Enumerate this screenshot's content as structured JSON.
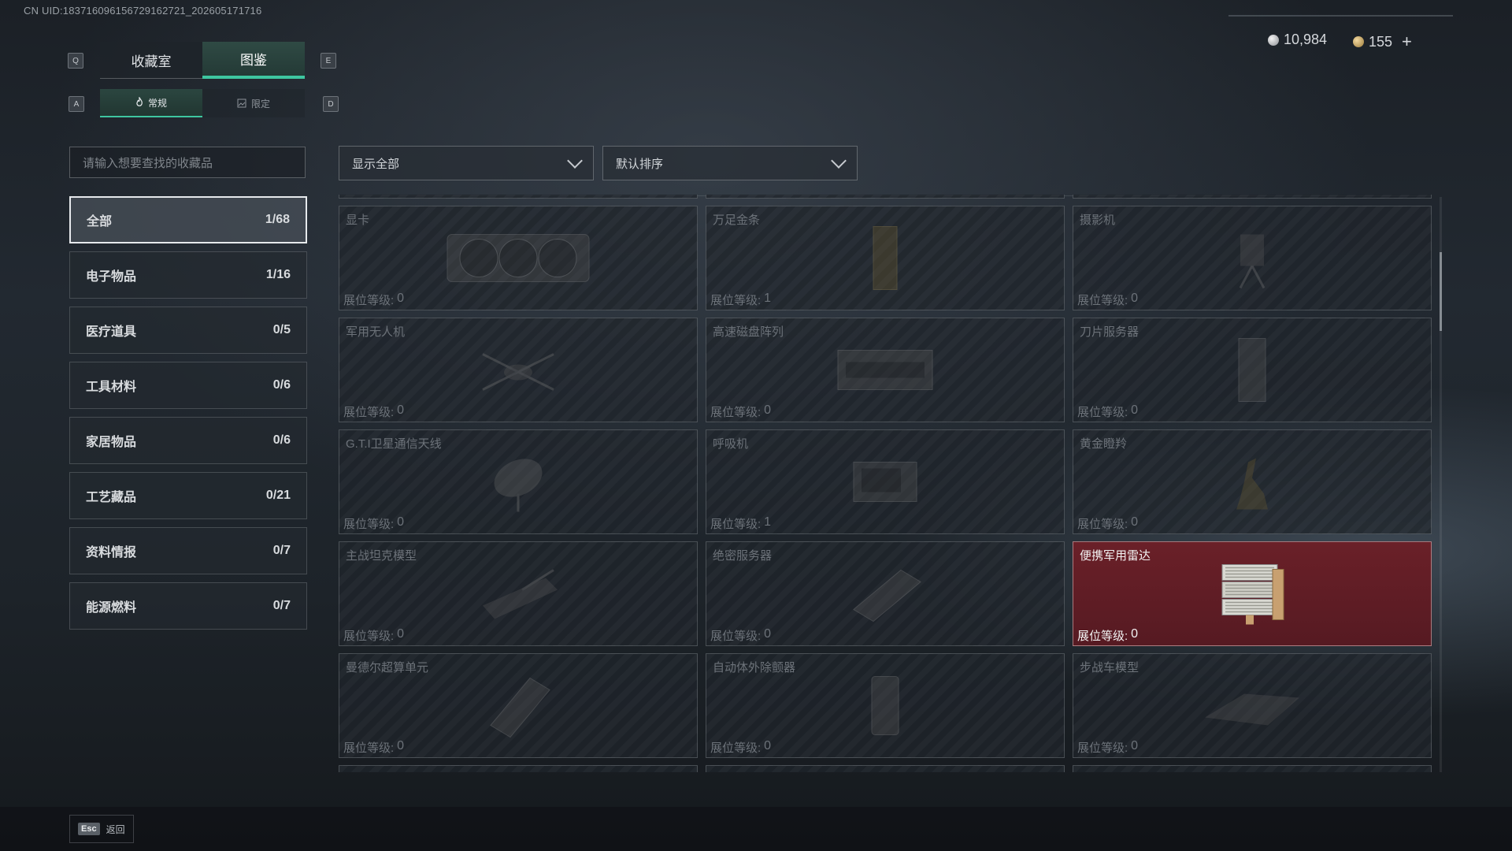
{
  "uid": "CN UID:183716096156729162721_202605171716",
  "currency": {
    "silver": "10,984",
    "gold": "155",
    "add": "+"
  },
  "keys": {
    "prev_tab": "Q",
    "next_tab": "E",
    "prev_sub": "A",
    "next_sub": "D"
  },
  "tabs": [
    {
      "label": "收藏室"
    },
    {
      "label": "图鉴"
    }
  ],
  "subtabs": [
    {
      "label": "常规"
    },
    {
      "label": "限定"
    }
  ],
  "search": {
    "placeholder": "请输入想要查找的收藏品"
  },
  "filters": {
    "show": "显示全部",
    "sort": "默认排序"
  },
  "categories": [
    {
      "label": "全部",
      "count": "1/68"
    },
    {
      "label": "电子物品",
      "count": "1/16"
    },
    {
      "label": "医疗道具",
      "count": "0/5"
    },
    {
      "label": "工具材料",
      "count": "0/6"
    },
    {
      "label": "家居物品",
      "count": "0/6"
    },
    {
      "label": "工艺藏品",
      "count": "0/21"
    },
    {
      "label": "资料情报",
      "count": "0/7"
    },
    {
      "label": "能源燃料",
      "count": "0/7"
    }
  ],
  "level_label": "展位等级:",
  "items": [
    {
      "name": "显卡",
      "level": "0",
      "icon": "gpu-icon"
    },
    {
      "name": "万足金条",
      "level": "1",
      "icon": "gold-bar-icon"
    },
    {
      "name": "摄影机",
      "level": "0",
      "icon": "camera-icon"
    },
    {
      "name": "军用无人机",
      "level": "0",
      "icon": "drone-icon"
    },
    {
      "name": "高速磁盘阵列",
      "level": "0",
      "icon": "disk-array-icon"
    },
    {
      "name": "刀片服务器",
      "level": "0",
      "icon": "blade-server-icon"
    },
    {
      "name": "G.T.I卫星通信天线",
      "level": "0",
      "icon": "satellite-dish-icon"
    },
    {
      "name": "呼吸机",
      "level": "1",
      "icon": "ventilator-icon"
    },
    {
      "name": "黄金瞪羚",
      "level": "0",
      "icon": "gazelle-statue-icon"
    },
    {
      "name": "主战坦克模型",
      "level": "0",
      "icon": "tank-model-icon"
    },
    {
      "name": "绝密服务器",
      "level": "0",
      "icon": "server-icon"
    },
    {
      "name": "便携军用雷达",
      "level": "0",
      "icon": "radar-icon",
      "owned": true
    },
    {
      "name": "曼德尔超算单元",
      "level": "0",
      "icon": "supercomputer-icon"
    },
    {
      "name": "自动体外除颤器",
      "level": "0",
      "icon": "defibrillator-icon"
    },
    {
      "name": "步战车模型",
      "level": "0",
      "icon": "ifv-model-icon"
    }
  ],
  "esc": {
    "key": "Esc",
    "label": "返回"
  }
}
